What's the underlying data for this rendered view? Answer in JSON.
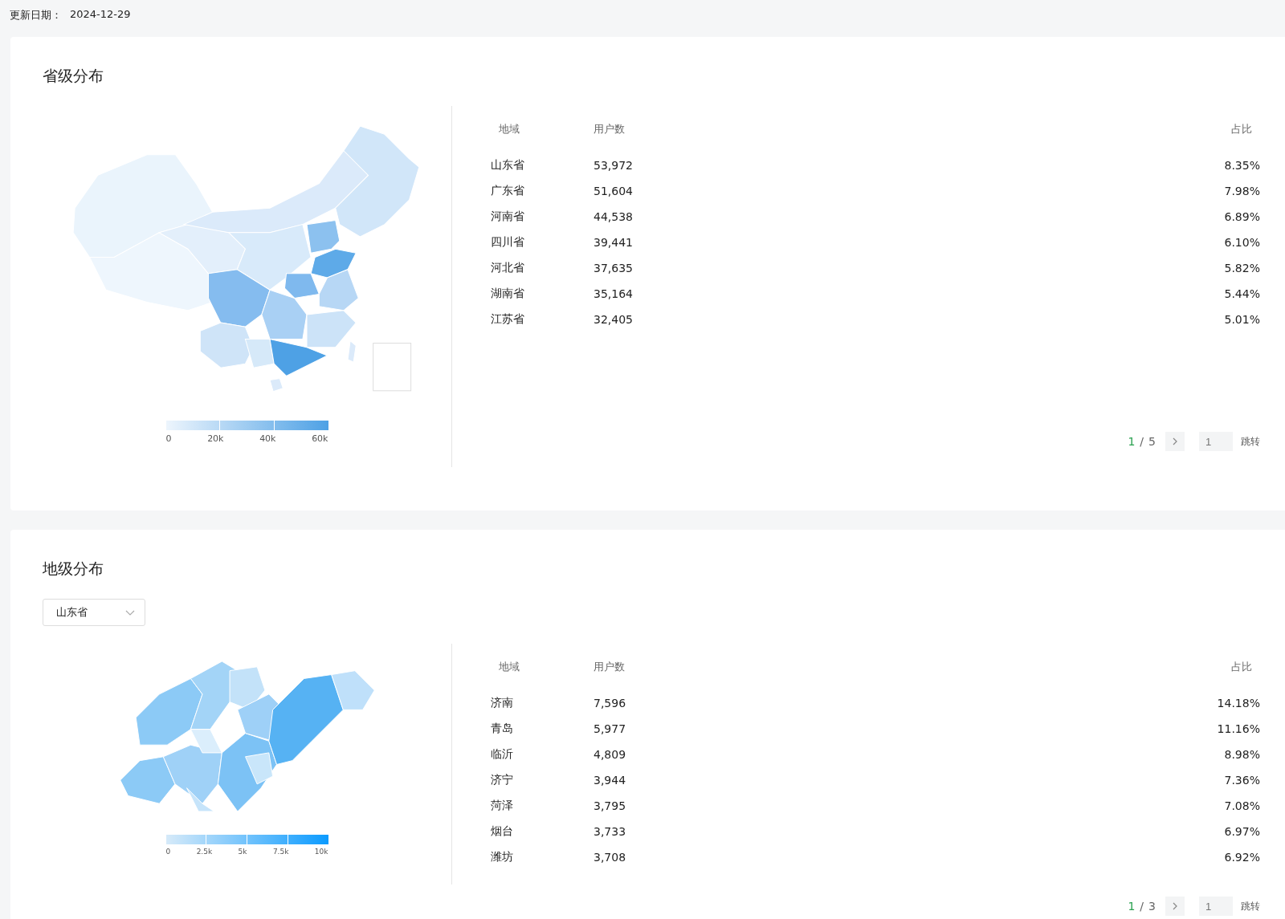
{
  "update_date": {
    "label": "更新日期：",
    "value": "2024-12-29"
  },
  "sections": [
    {
      "kind": "country",
      "title": "省级分布",
      "legend": {
        "ticks": [
          "0",
          "20k",
          "40k",
          "60k"
        ]
      },
      "columns": [
        "地域",
        "用户数",
        "占比"
      ],
      "rows": [
        {
          "region": "山东省",
          "users": "53,972",
          "share": "8.35%"
        },
        {
          "region": "广东省",
          "users": "51,604",
          "share": "7.98%"
        },
        {
          "region": "河南省",
          "users": "44,538",
          "share": "6.89%"
        },
        {
          "region": "四川省",
          "users": "39,441",
          "share": "6.10%"
        },
        {
          "region": "河北省",
          "users": "37,635",
          "share": "5.82%"
        },
        {
          "region": "湖南省",
          "users": "35,164",
          "share": "5.44%"
        },
        {
          "region": "江苏省",
          "users": "32,405",
          "share": "5.01%"
        }
      ],
      "pagination": {
        "page": "1",
        "separator": "/",
        "total": "5",
        "jump_placeholder": "1",
        "jump_label": "跳转"
      }
    },
    {
      "kind": "province",
      "title": "地级分布",
      "dropdown": {
        "value": "山东省"
      },
      "legend": {
        "ticks": [
          "0",
          "2.5k",
          "5k",
          "7.5k",
          "10k"
        ]
      },
      "columns": [
        "地域",
        "用户数",
        "占比"
      ],
      "rows": [
        {
          "region": "济南",
          "users": "7,596",
          "share": "14.18%"
        },
        {
          "region": "青岛",
          "users": "5,977",
          "share": "11.16%"
        },
        {
          "region": "临沂",
          "users": "4,809",
          "share": "8.98%"
        },
        {
          "region": "济宁",
          "users": "3,944",
          "share": "7.36%"
        },
        {
          "region": "菏泽",
          "users": "3,795",
          "share": "7.08%"
        },
        {
          "region": "烟台",
          "users": "3,733",
          "share": "6.97%"
        },
        {
          "region": "潍坊",
          "users": "3,708",
          "share": "6.92%"
        }
      ],
      "pagination": {
        "page": "1",
        "separator": "/",
        "total": "3",
        "jump_placeholder": "1",
        "jump_label": "跳转"
      }
    }
  ]
}
